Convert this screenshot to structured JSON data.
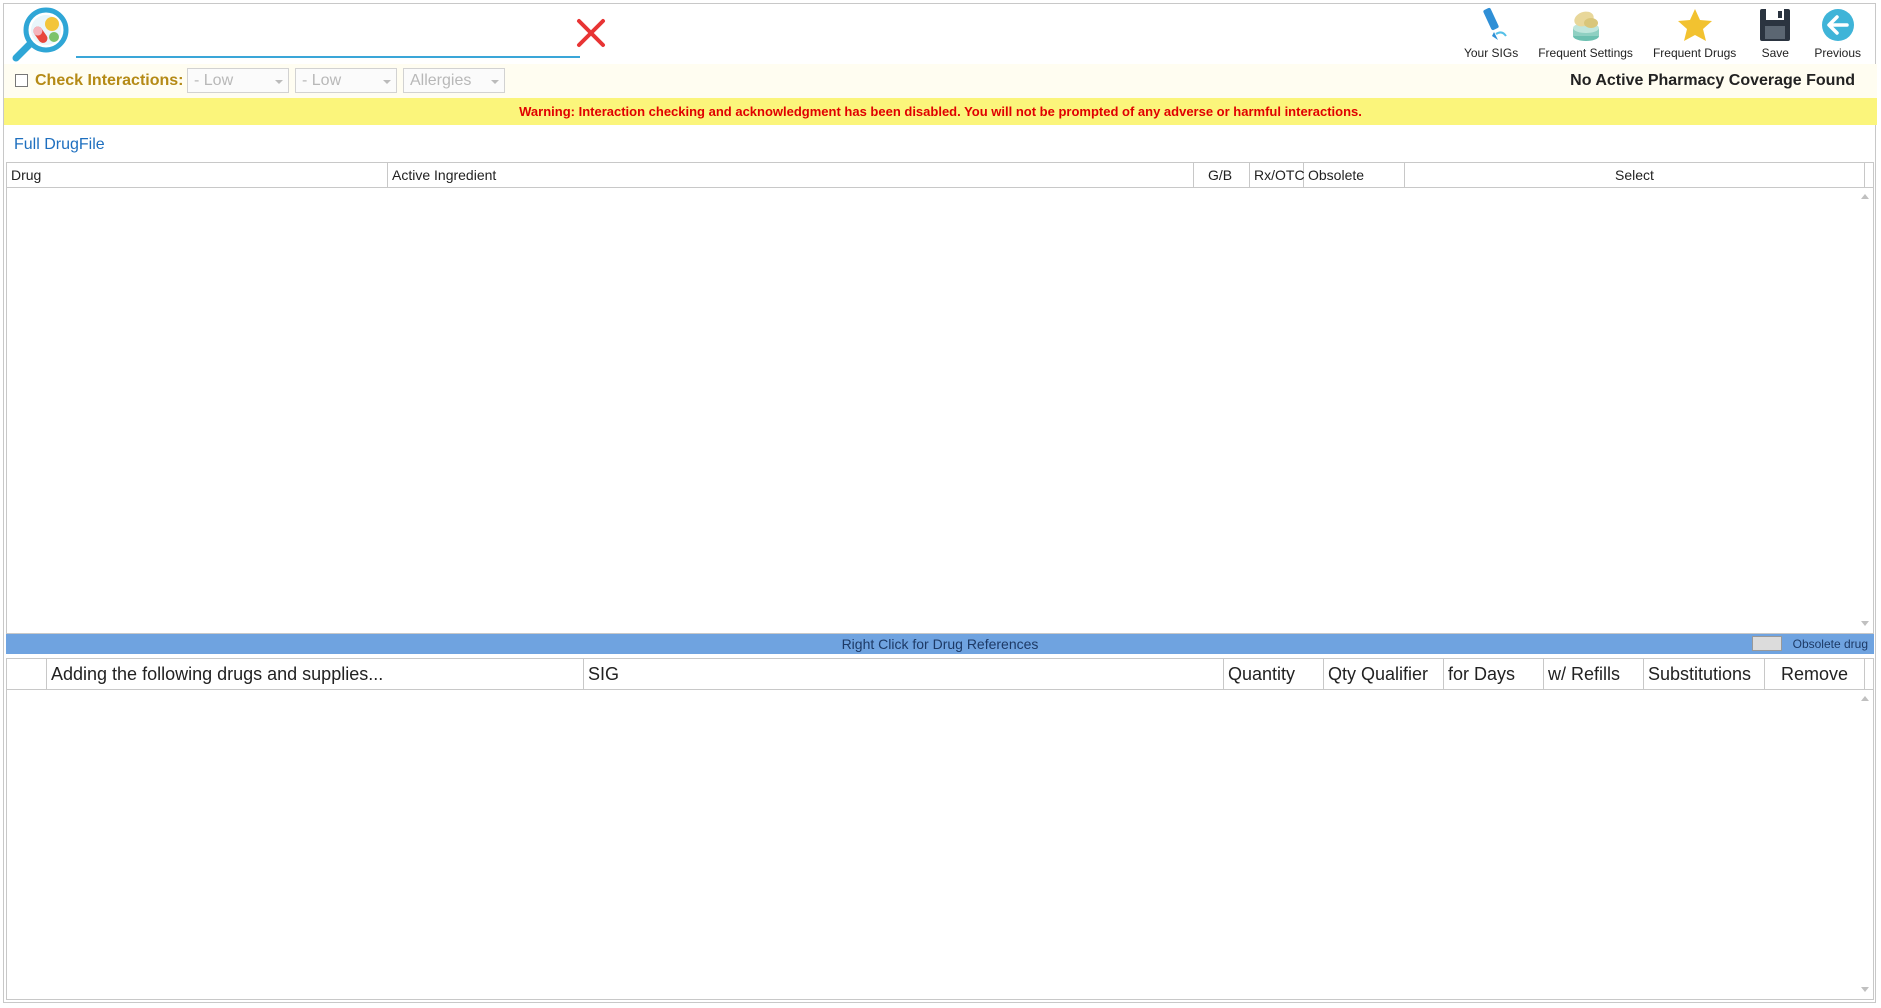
{
  "search": {
    "placeholder": "",
    "value": ""
  },
  "toolbar": {
    "your_sigs": "Your SIGs",
    "frequent_settings": "Frequent Settings",
    "frequent_drugs": "Frequent Drugs",
    "save": "Save",
    "previous": "Previous"
  },
  "interactions": {
    "label": "Check Interactions:",
    "checked": false,
    "select1": "- Low",
    "select2": "- Low",
    "select3": "Allergies"
  },
  "coverage": "No Active Pharmacy Coverage Found",
  "warning": "Warning: Interaction checking and acknowledgment has been disabled. You will not be prompted of any adverse or harmful interactions.",
  "section_title": "Full DrugFile",
  "drug_table": {
    "columns": [
      "Drug",
      "Active Ingredient",
      "G/B",
      "Rx/OTC",
      "Obsolete",
      "Select"
    ],
    "rows": []
  },
  "statusbar": {
    "text": "Right Click for Drug References",
    "legend": "Obsolete drug"
  },
  "add_table": {
    "columns": [
      "",
      "Adding the following drugs and supplies...",
      "SIG",
      "Quantity",
      "Qty Qualifier",
      "for Days",
      "w/ Refills",
      "Substitutions",
      "Remove"
    ],
    "rows": []
  },
  "colors": {
    "warning_bg": "#fbf57b",
    "warning_text": "#e00000",
    "accent": "#3aa6d8",
    "statusbar": "#6fa3e0",
    "interaction_label": "#b58a16"
  }
}
